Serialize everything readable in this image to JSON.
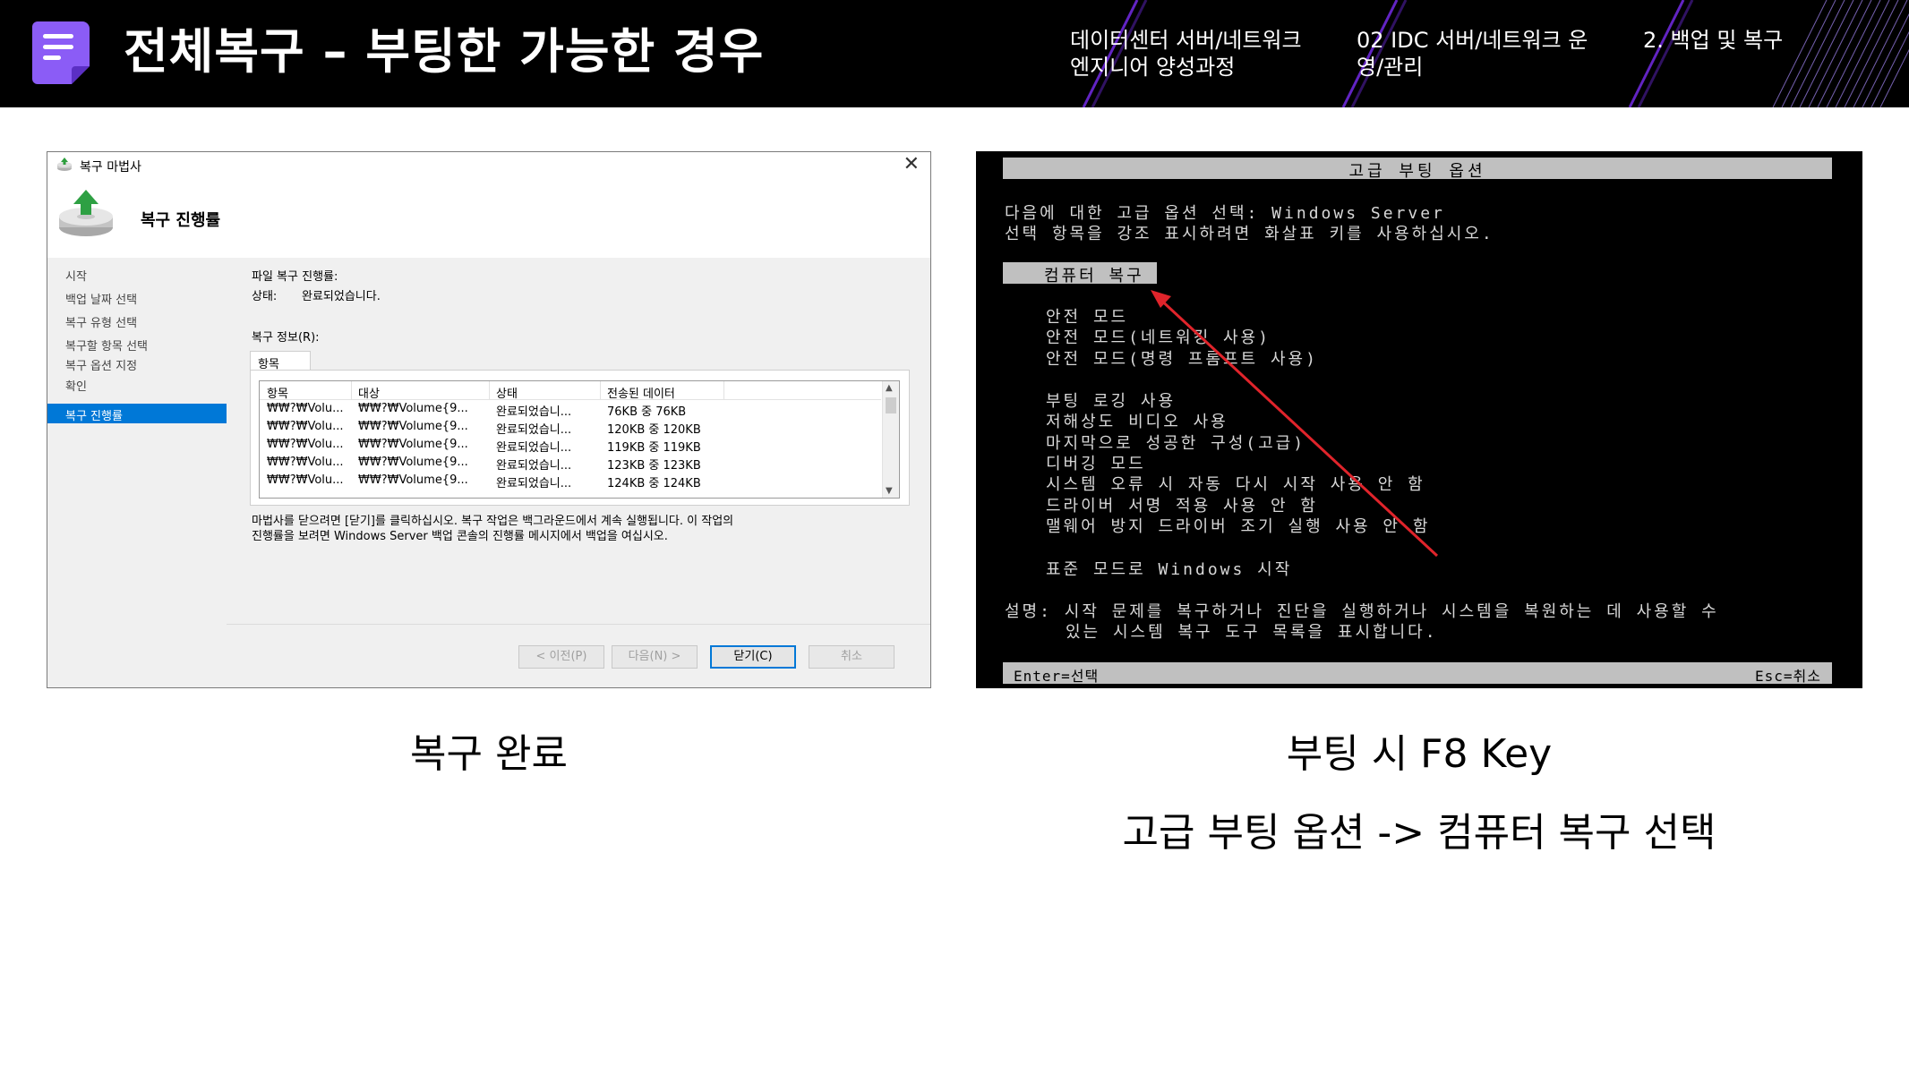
{
  "header": {
    "title": "전체복구 – 부팅한 가능한 경우",
    "breadcrumbs": [
      "데이터센터 서버/네트워크 엔지니어 양성과정",
      "02 IDC 서버/네트워크 운영/관리",
      "2. 백업 및 복구"
    ],
    "logo_icon": "document-icon",
    "accent_color": "#8b5cf6"
  },
  "wizard": {
    "window_title": "복구 마법사",
    "heading": "복구 진행률",
    "nav": [
      "시작",
      "백업 날짜 선택",
      "복구 유형 선택",
      "복구할 항목 선택",
      "복구 옵션 지정",
      "확인",
      "복구 진행률"
    ],
    "file_progress_label": "파일 복구 진행률:",
    "status_label": "상태:",
    "status_value": "완료되었습니다.",
    "info_label": "복구 정보(R):",
    "tab_label": "항목",
    "columns": [
      "항목",
      "대상",
      "상태",
      "전송된 데이터"
    ],
    "rows": [
      [
        "₩₩?₩Volu...",
        "₩₩?₩Volume{9...",
        "완료되었습니...",
        "76KB 중 76KB"
      ],
      [
        "₩₩?₩Volu...",
        "₩₩?₩Volume{9...",
        "완료되었습니...",
        "120KB 중 120KB"
      ],
      [
        "₩₩?₩Volu...",
        "₩₩?₩Volume{9...",
        "완료되었습니...",
        "119KB 중 119KB"
      ],
      [
        "₩₩?₩Volu...",
        "₩₩?₩Volume{9...",
        "완료되었습니...",
        "123KB 중 123KB"
      ],
      [
        "₩₩?₩Volu...",
        "₩₩?₩Volume{9...",
        "완료되었습니...",
        "124KB 중 124KB"
      ]
    ],
    "note_line1": "마법사를 닫으려면 [닫기]를 클릭하십시오. 복구 작업은 백그라운드에서 계속 실행됩니다. 이 작업의",
    "note_line2": "진행률을 보려면 Windows Server 백업 콘솔의 진행률 메시지에서 백업을 여십시오.",
    "buttons": {
      "prev": "< 이전(P)",
      "next": "다음(N) >",
      "close": "닫기(C)",
      "cancel": "취소"
    }
  },
  "boot": {
    "title": "고급 부팅 옵션",
    "line1": "다음에 대한 고급 옵션 선택: Windows Server",
    "line2": "선택 항목을 강조 표시하려면 화살표 키를 사용하십시오.",
    "selected": "컴퓨터 복구",
    "options_group1": [
      "안전 모드",
      "안전 모드(네트워킹 사용)",
      "안전 모드(명령 프롬프트 사용)"
    ],
    "options_group2": [
      "부팅 로깅 사용",
      "저해상도 비디오 사용",
      "마지막으로 성공한 구성(고급)",
      "디버깅 모드",
      "시스템 오류 시 자동 다시 시작 사용 안 함",
      "드라이버 서명 적용 사용 안 함",
      "맬웨어 방지 드라이버 조기 실행 사용 안 함"
    ],
    "normal_start": "표준 모드로 Windows 시작",
    "desc_line1": "설명: 시작 문제를 복구하거나 진단을 실행하거나 시스템을 복원하는 데 사용할 수",
    "desc_line2": "있는 시스템 복구 도구 목록을 표시합니다.",
    "footer_left": "Enter=선택",
    "footer_right": "Esc=취소",
    "arrow_color": "#e0242b"
  },
  "captions": {
    "left": "복구 완료",
    "right1": "부팅 시 F8 Key",
    "right2": "고급 부팅 옵션 -> 컴퓨터 복구 선택"
  }
}
